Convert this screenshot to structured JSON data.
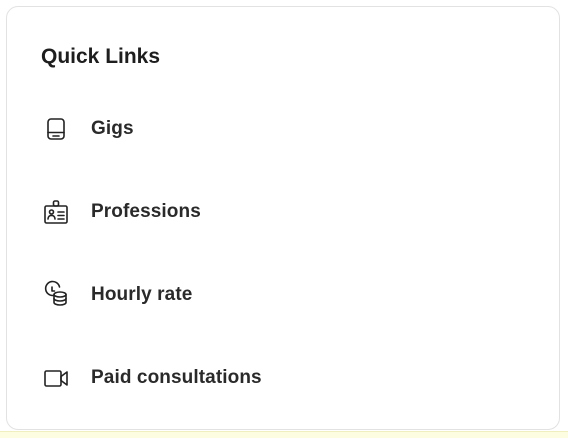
{
  "card": {
    "title": "Quick Links"
  },
  "links": [
    {
      "label": "Gigs",
      "icon": "tablet-icon"
    },
    {
      "label": "Professions",
      "icon": "id-badge-icon"
    },
    {
      "label": "Hourly rate",
      "icon": "clock-coins-icon"
    },
    {
      "label": "Paid consultations",
      "icon": "video-camera-icon"
    }
  ],
  "colors": {
    "text": "#2a2a2a",
    "border": "#e2e2e2",
    "background": "#ffffff"
  }
}
